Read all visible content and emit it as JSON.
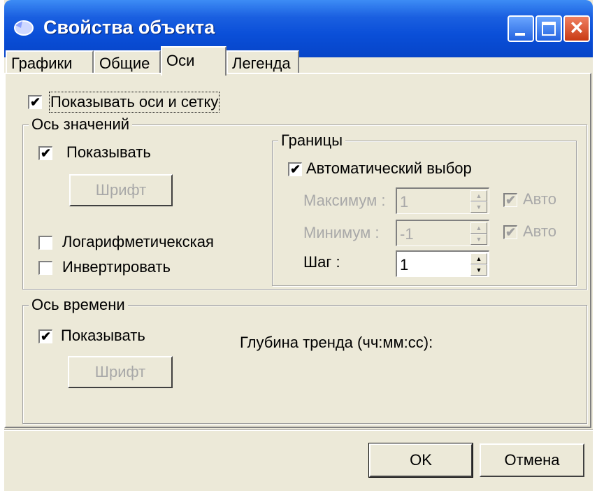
{
  "window": {
    "title": "Свойства объекта",
    "minimize_icon": "minimize-icon",
    "maximize_icon": "maximize-icon",
    "close_icon": "close-icon"
  },
  "tabs": [
    {
      "label": "Графики",
      "active": false
    },
    {
      "label": "Общие",
      "active": false
    },
    {
      "label": "Оси",
      "active": true
    },
    {
      "label": "Легенда",
      "active": false
    }
  ],
  "show_axes": {
    "label": "Показывать оси и сетку",
    "checked": true
  },
  "value_axis": {
    "title": "Ось значений",
    "show": {
      "label": "Показывать",
      "checked": true
    },
    "font_button": "Шрифт",
    "logarithmic": {
      "label": "Логарифметичекская",
      "checked": false
    },
    "invert": {
      "label": "Инвертировать",
      "checked": false
    },
    "bounds": {
      "title": "Границы",
      "auto": {
        "label": "Автоматический выбор",
        "checked": true
      },
      "max": {
        "label": "Максимум :",
        "value": "1",
        "auto_label": "Авто",
        "auto_checked": true
      },
      "min": {
        "label": "Минимум :",
        "value": "-1",
        "auto_label": "Авто",
        "auto_checked": true
      },
      "step": {
        "label": "Шаг :",
        "value": "1"
      }
    }
  },
  "time_axis": {
    "title": "Ось времени",
    "show": {
      "label": "Показывать",
      "checked": true
    },
    "font_button": "Шрифт",
    "depth_label": "Глубина тренда (чч:мм:сс):"
  },
  "buttons": {
    "ok": "OK",
    "cancel": "Отмена"
  },
  "check_glyph": "✔",
  "colors": {
    "titlebar": "#0a4fd8",
    "face": "#ece9d8",
    "close": "#c83a14"
  }
}
